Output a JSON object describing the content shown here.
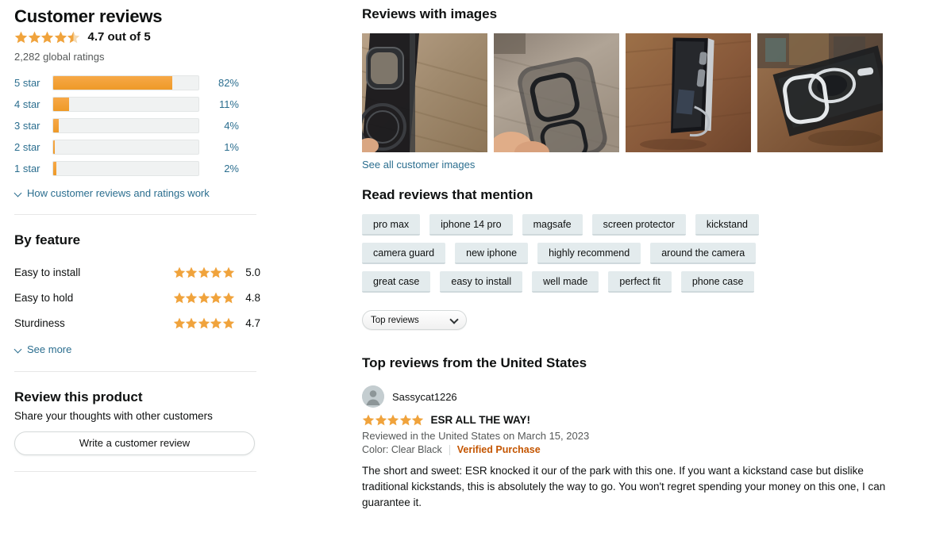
{
  "left": {
    "title": "Customer reviews",
    "overall_stars": 4.5,
    "overall_text": "4.7 out of 5",
    "global_ratings": "2,282 global ratings",
    "histogram": [
      {
        "label": "5 star",
        "pct": "82%",
        "value": 82
      },
      {
        "label": "4 star",
        "pct": "11%",
        "value": 11
      },
      {
        "label": "3 star",
        "pct": "4%",
        "value": 4
      },
      {
        "label": "2 star",
        "pct": "1%",
        "value": 1
      },
      {
        "label": "1 star",
        "pct": "2%",
        "value": 2
      }
    ],
    "how_reviews_work": "How customer reviews and ratings work",
    "by_feature_title": "By feature",
    "features": [
      {
        "name": "Easy to install",
        "value": "5.0",
        "stars": 5
      },
      {
        "name": "Easy to hold",
        "value": "4.8",
        "stars": 5
      },
      {
        "name": "Sturdiness",
        "value": "4.7",
        "stars": 5
      }
    ],
    "see_more": "See more",
    "review_product_title": "Review this product",
    "review_product_sub": "Share your thoughts with other customers",
    "write_review_button": "Write a customer review"
  },
  "right": {
    "images_title": "Reviews with images",
    "thumbnails": [
      "phone-case-closeup-on-wood-thumbnail",
      "clear-case-held-in-hand-thumbnail",
      "phone-standing-on-kickstand-thumbnail",
      "case-kickstand-magsafe-ring-thumbnail"
    ],
    "see_all_images": "See all customer images",
    "mention_title": "Read reviews that mention",
    "keywords": [
      "pro max",
      "iphone 14 pro",
      "magsafe",
      "screen protector",
      "kickstand",
      "camera guard",
      "new iphone",
      "highly recommend",
      "around the camera",
      "great case",
      "easy to install",
      "well made",
      "perfect fit",
      "phone case"
    ],
    "sort_selected": "Top reviews",
    "top_reviews_title": "Top reviews from the United States",
    "reviews": [
      {
        "author": "Sassycat1226",
        "stars": 5,
        "title": "ESR ALL THE WAY!",
        "date": "Reviewed in the United States on March 15, 2023",
        "color": "Color: Clear Black",
        "verified": "Verified Purchase",
        "body": "The short and sweet: ESR knocked it our of the park with this one. If you want a kickstand case but dislike traditional kickstands, this is absolutely the way to go. You won't regret spending your money on this one, I can guarantee it."
      }
    ]
  },
  "colors": {
    "star": "#F0A33C",
    "star_empty": "#F4D9B0",
    "link": "#2B6E8F",
    "bar_fill": "#F0A33C",
    "bar_track": "#F0F2F2",
    "verified": "#C45500",
    "chip_bg": "#E3EBED"
  }
}
